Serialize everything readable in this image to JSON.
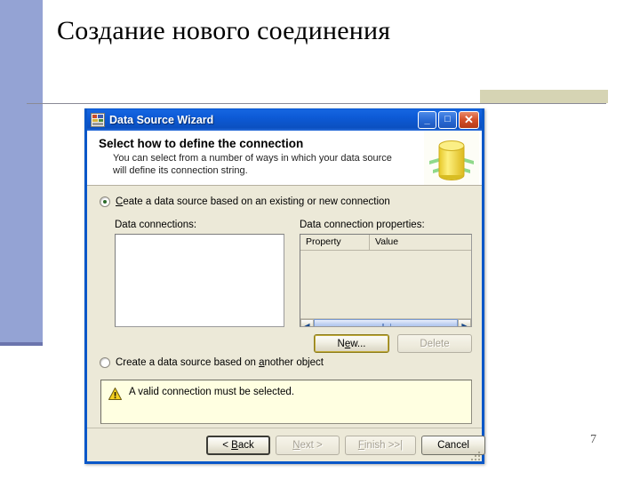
{
  "slide": {
    "title": "Создание нового соединения",
    "page_number": "7",
    "accent_band_color": "#94a3d4",
    "right_band_color": "#d6d4b4",
    "rule_color": "#8a8a96"
  },
  "dialog": {
    "titlebar": {
      "title": "Data Source Wizard",
      "icon": "app-window-icon",
      "minimize_glyph": "_",
      "maximize_glyph": "□",
      "close_glyph": "✕"
    },
    "header": {
      "heading": "Select how to define the connection",
      "description": "You can select from a number of ways in which your data source will define its connection string.",
      "artwork": "database-cylinder-icon"
    },
    "options": [
      {
        "id": "existing-or-new-connection",
        "label_before": "C",
        "label_accel": "r",
        "label_after": "eate a data source based on an existing or new connection",
        "label_full": "Create a data source based on an existing or new connection",
        "checked": true
      },
      {
        "id": "another-object",
        "label_full": "Create a data source based on another object",
        "checked": false
      }
    ],
    "labels": {
      "data_connections": "Data connections:",
      "data_connection_properties": "Data connection properties:"
    },
    "connections_list": {
      "items": []
    },
    "properties_grid": {
      "columns": [
        "Property",
        "Value"
      ],
      "rows": []
    },
    "side_buttons": [
      {
        "id": "new-button",
        "label": "New...",
        "enabled": true,
        "focused": true
      },
      {
        "id": "delete-button",
        "label": "Delete",
        "enabled": false,
        "focused": false
      }
    ],
    "warning": {
      "icon": "warning-triangle-icon",
      "message": "A valid connection must be selected.",
      "background": "#ffffe1"
    },
    "footer_buttons": [
      {
        "id": "back-button",
        "label": "< Back",
        "enabled": true
      },
      {
        "id": "next-button",
        "label": "Next >",
        "enabled": false
      },
      {
        "id": "finish-button",
        "label": "Finish >>|",
        "enabled": false
      },
      {
        "id": "cancel-button",
        "label": "Cancel",
        "enabled": true
      }
    ],
    "colors": {
      "titlebar_blue": "#0d5ad6",
      "face": "#ece9d8",
      "border_blue": "#0a57c8"
    }
  }
}
